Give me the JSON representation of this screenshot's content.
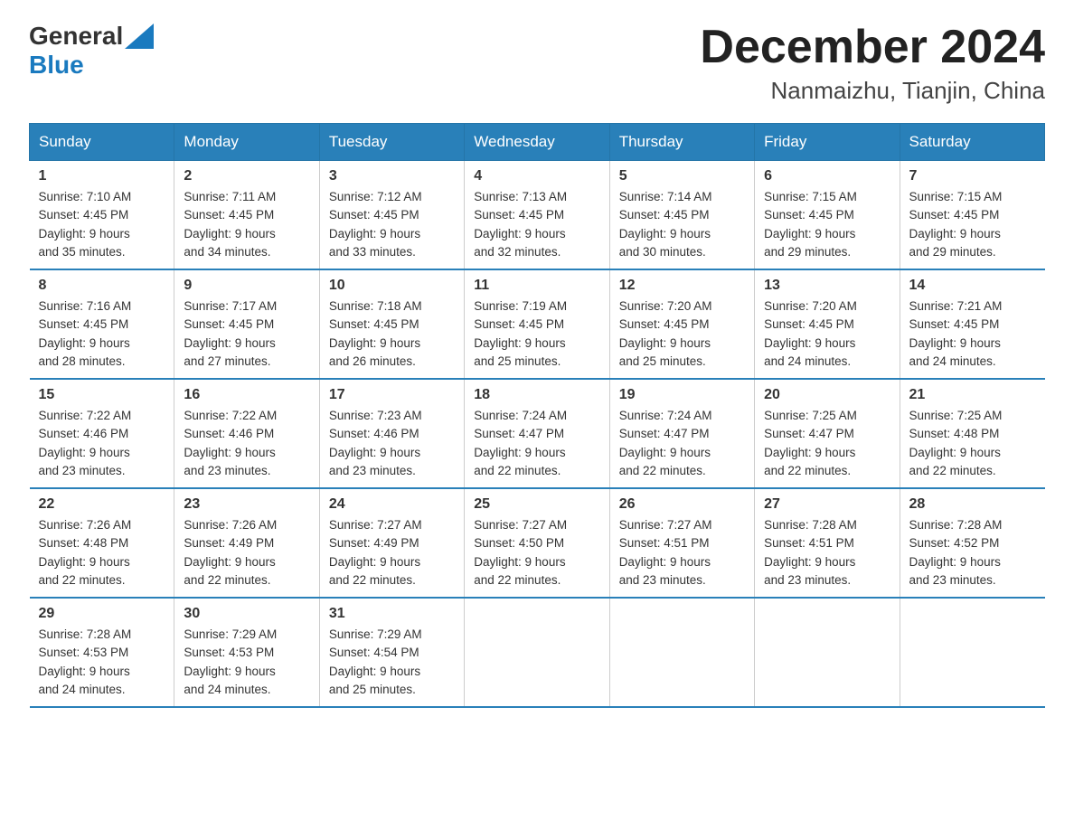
{
  "header": {
    "logo_general": "General",
    "logo_blue": "Blue",
    "month_title": "December 2024",
    "location": "Nanmaizhu, Tianjin, China"
  },
  "weekdays": [
    "Sunday",
    "Monday",
    "Tuesday",
    "Wednesday",
    "Thursday",
    "Friday",
    "Saturday"
  ],
  "weeks": [
    [
      {
        "day": "1",
        "sunrise": "7:10 AM",
        "sunset": "4:45 PM",
        "daylight": "9 hours and 35 minutes."
      },
      {
        "day": "2",
        "sunrise": "7:11 AM",
        "sunset": "4:45 PM",
        "daylight": "9 hours and 34 minutes."
      },
      {
        "day": "3",
        "sunrise": "7:12 AM",
        "sunset": "4:45 PM",
        "daylight": "9 hours and 33 minutes."
      },
      {
        "day": "4",
        "sunrise": "7:13 AM",
        "sunset": "4:45 PM",
        "daylight": "9 hours and 32 minutes."
      },
      {
        "day": "5",
        "sunrise": "7:14 AM",
        "sunset": "4:45 PM",
        "daylight": "9 hours and 30 minutes."
      },
      {
        "day": "6",
        "sunrise": "7:15 AM",
        "sunset": "4:45 PM",
        "daylight": "9 hours and 29 minutes."
      },
      {
        "day": "7",
        "sunrise": "7:15 AM",
        "sunset": "4:45 PM",
        "daylight": "9 hours and 29 minutes."
      }
    ],
    [
      {
        "day": "8",
        "sunrise": "7:16 AM",
        "sunset": "4:45 PM",
        "daylight": "9 hours and 28 minutes."
      },
      {
        "day": "9",
        "sunrise": "7:17 AM",
        "sunset": "4:45 PM",
        "daylight": "9 hours and 27 minutes."
      },
      {
        "day": "10",
        "sunrise": "7:18 AM",
        "sunset": "4:45 PM",
        "daylight": "9 hours and 26 minutes."
      },
      {
        "day": "11",
        "sunrise": "7:19 AM",
        "sunset": "4:45 PM",
        "daylight": "9 hours and 25 minutes."
      },
      {
        "day": "12",
        "sunrise": "7:20 AM",
        "sunset": "4:45 PM",
        "daylight": "9 hours and 25 minutes."
      },
      {
        "day": "13",
        "sunrise": "7:20 AM",
        "sunset": "4:45 PM",
        "daylight": "9 hours and 24 minutes."
      },
      {
        "day": "14",
        "sunrise": "7:21 AM",
        "sunset": "4:45 PM",
        "daylight": "9 hours and 24 minutes."
      }
    ],
    [
      {
        "day": "15",
        "sunrise": "7:22 AM",
        "sunset": "4:46 PM",
        "daylight": "9 hours and 23 minutes."
      },
      {
        "day": "16",
        "sunrise": "7:22 AM",
        "sunset": "4:46 PM",
        "daylight": "9 hours and 23 minutes."
      },
      {
        "day": "17",
        "sunrise": "7:23 AM",
        "sunset": "4:46 PM",
        "daylight": "9 hours and 23 minutes."
      },
      {
        "day": "18",
        "sunrise": "7:24 AM",
        "sunset": "4:47 PM",
        "daylight": "9 hours and 22 minutes."
      },
      {
        "day": "19",
        "sunrise": "7:24 AM",
        "sunset": "4:47 PM",
        "daylight": "9 hours and 22 minutes."
      },
      {
        "day": "20",
        "sunrise": "7:25 AM",
        "sunset": "4:47 PM",
        "daylight": "9 hours and 22 minutes."
      },
      {
        "day": "21",
        "sunrise": "7:25 AM",
        "sunset": "4:48 PM",
        "daylight": "9 hours and 22 minutes."
      }
    ],
    [
      {
        "day": "22",
        "sunrise": "7:26 AM",
        "sunset": "4:48 PM",
        "daylight": "9 hours and 22 minutes."
      },
      {
        "day": "23",
        "sunrise": "7:26 AM",
        "sunset": "4:49 PM",
        "daylight": "9 hours and 22 minutes."
      },
      {
        "day": "24",
        "sunrise": "7:27 AM",
        "sunset": "4:49 PM",
        "daylight": "9 hours and 22 minutes."
      },
      {
        "day": "25",
        "sunrise": "7:27 AM",
        "sunset": "4:50 PM",
        "daylight": "9 hours and 22 minutes."
      },
      {
        "day": "26",
        "sunrise": "7:27 AM",
        "sunset": "4:51 PM",
        "daylight": "9 hours and 23 minutes."
      },
      {
        "day": "27",
        "sunrise": "7:28 AM",
        "sunset": "4:51 PM",
        "daylight": "9 hours and 23 minutes."
      },
      {
        "day": "28",
        "sunrise": "7:28 AM",
        "sunset": "4:52 PM",
        "daylight": "9 hours and 23 minutes."
      }
    ],
    [
      {
        "day": "29",
        "sunrise": "7:28 AM",
        "sunset": "4:53 PM",
        "daylight": "9 hours and 24 minutes."
      },
      {
        "day": "30",
        "sunrise": "7:29 AM",
        "sunset": "4:53 PM",
        "daylight": "9 hours and 24 minutes."
      },
      {
        "day": "31",
        "sunrise": "7:29 AM",
        "sunset": "4:54 PM",
        "daylight": "9 hours and 25 minutes."
      },
      {
        "day": "",
        "sunrise": "",
        "sunset": "",
        "daylight": ""
      },
      {
        "day": "",
        "sunrise": "",
        "sunset": "",
        "daylight": ""
      },
      {
        "day": "",
        "sunrise": "",
        "sunset": "",
        "daylight": ""
      },
      {
        "day": "",
        "sunrise": "",
        "sunset": "",
        "daylight": ""
      }
    ]
  ],
  "labels": {
    "sunrise_prefix": "Sunrise: ",
    "sunset_prefix": "Sunset: ",
    "daylight_prefix": "Daylight: "
  }
}
